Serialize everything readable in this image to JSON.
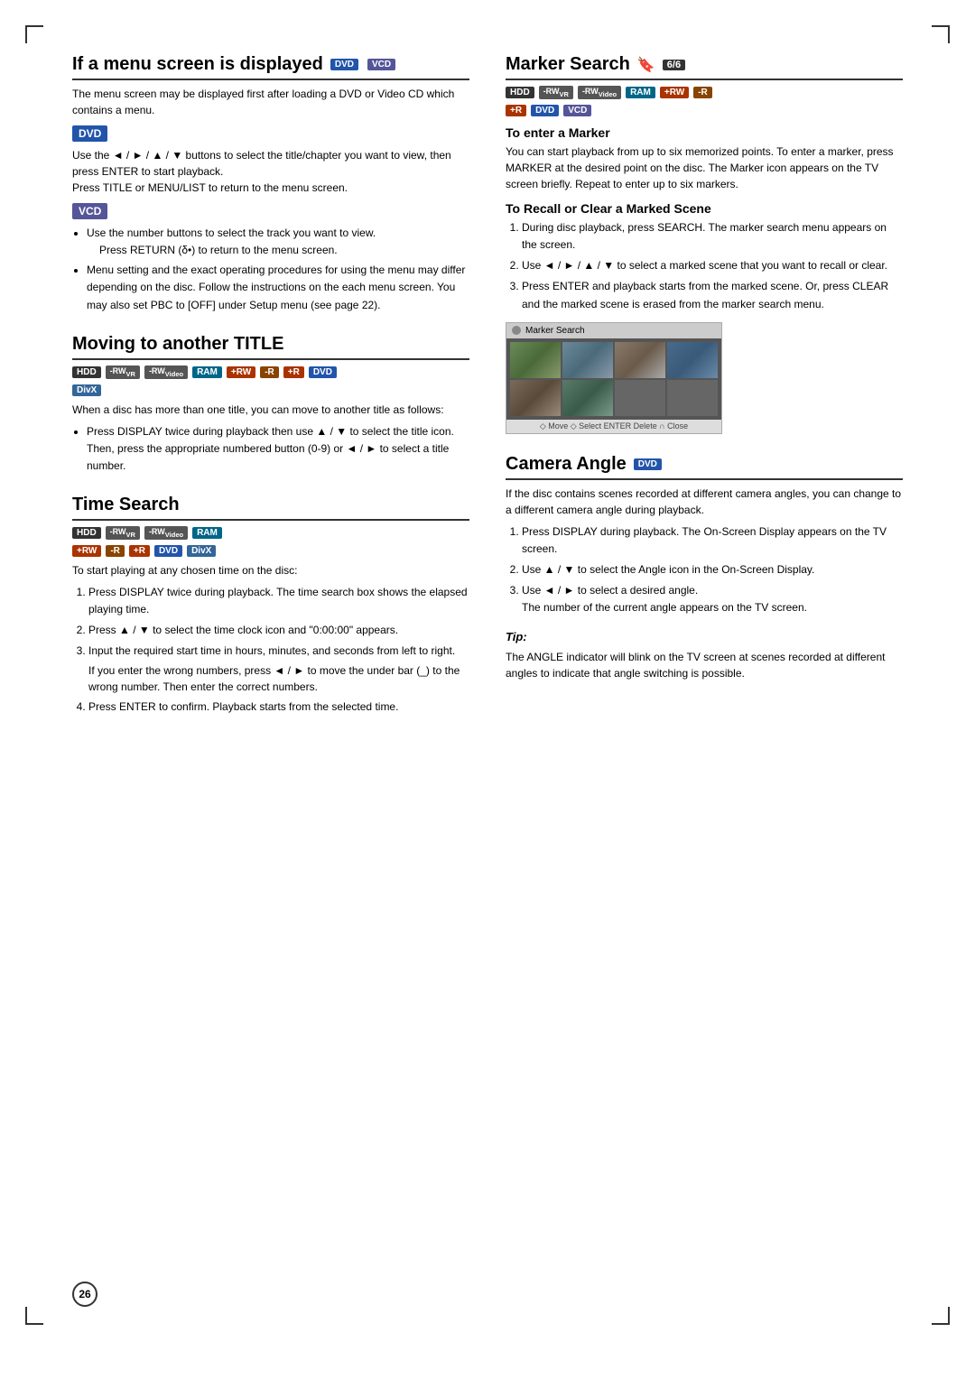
{
  "page": {
    "number": "26",
    "left_column": {
      "section1": {
        "title": "If a menu screen is displayed",
        "badges": [
          "DVD",
          "VCD"
        ],
        "intro": "The menu screen may be displayed first after loading a DVD or Video CD which contains a menu.",
        "dvd_heading": "DVD",
        "dvd_text": "Use the ◄ / ► / ▲ / ▼ buttons to select the title/chapter you want to view, then press ENTER to start playback.\nPress TITLE or MENU/LIST to return to the menu screen.",
        "vcd_heading": "VCD",
        "vcd_bullets": [
          "Use the number buttons to select the track you want to view.",
          "Press RETURN (δ•) to return to the menu screen.",
          "Menu setting and the exact operating procedures for using the menu may differ depending on the disc. Follow the instructions on the each menu screen. You may also set PBC to [OFF] under Setup menu (see page 22)."
        ]
      },
      "section2": {
        "title": "Moving to another TITLE",
        "badges": [
          "HDD",
          "-RWVR",
          "-RWVideo",
          "RAM",
          "+RW",
          "-R",
          "+R",
          "DVD",
          "DivX"
        ],
        "intro": "When a disc has more than one title, you can move to another title as follows:",
        "bullets": [
          "Press DISPLAY twice during playback then use ▲ / ▼ to select the title icon. Then, press the appropriate numbered button (0-9) or ◄ / ► to select a title number."
        ]
      },
      "section3": {
        "title": "Time Search",
        "badges_row1": [
          "HDD",
          "-RWVR",
          "-RWVideo",
          "RAM"
        ],
        "badges_row2": [
          "+RW",
          "-R",
          "+R",
          "DVD",
          "DivX"
        ],
        "intro": "To start playing at any chosen time on the disc:",
        "steps": [
          "Press DISPLAY twice during playback. The time search box shows the elapsed playing time.",
          "Press ▲ / ▼ to select the time clock icon and \"0:00:00\" appears.",
          "Input the required start time in hours, minutes, and seconds from left to right.",
          "Press ENTER to confirm. Playback starts from the selected time."
        ],
        "step3_note": "If you enter the wrong numbers, press ◄ / ► to move the under bar (_) to the wrong number. Then enter the correct numbers."
      }
    },
    "right_column": {
      "section1": {
        "title": "Marker Search",
        "icon": "🔖",
        "page_num": "6/6",
        "badges_row1": [
          "HDD",
          "-RWVR",
          "-RWVideo",
          "RAM",
          "+RW",
          "-R"
        ],
        "badges_row2": [
          "+R",
          "DVD",
          "VCD"
        ],
        "subsection1": {
          "heading": "To enter a Marker",
          "text": "You can start playback from up to six memorized points. To enter a marker, press MARKER at the desired point on the disc. The Marker icon appears on the TV screen briefly. Repeat to enter up to six markers."
        },
        "subsection2": {
          "heading": "To Recall or Clear a Marked Scene",
          "steps": [
            "During disc playback, press SEARCH. The marker search menu appears on the screen.",
            "Use ◄ / ► / ▲ / ▼ to select a marked scene that you want to recall or clear.",
            "Press ENTER and playback starts from the marked scene. Or, press CLEAR and the marked scene is erased from the marker search menu."
          ]
        },
        "marker_search_box": {
          "title": "Marker Search",
          "bottom_bar": "◇ Move ◇ Select ENTER Delete ∩ Close"
        }
      },
      "section2": {
        "title": "Camera Angle",
        "badges": [
          "DVD"
        ],
        "intro": "If the disc contains scenes recorded at different camera angles, you can change to a different camera angle during playback.",
        "steps": [
          "Press DISPLAY during playback. The On-Screen Display appears on the TV screen.",
          "Use ▲ / ▼ to select the Angle icon in the On-Screen Display.",
          "Use ◄ / ► to select a desired angle.\nThe number of the current angle appears on the TV screen."
        ],
        "tip": {
          "label": "Tip:",
          "text": "The ANGLE indicator will blink on the TV screen at scenes recorded at different angles to indicate that angle switching is possible."
        }
      }
    }
  }
}
